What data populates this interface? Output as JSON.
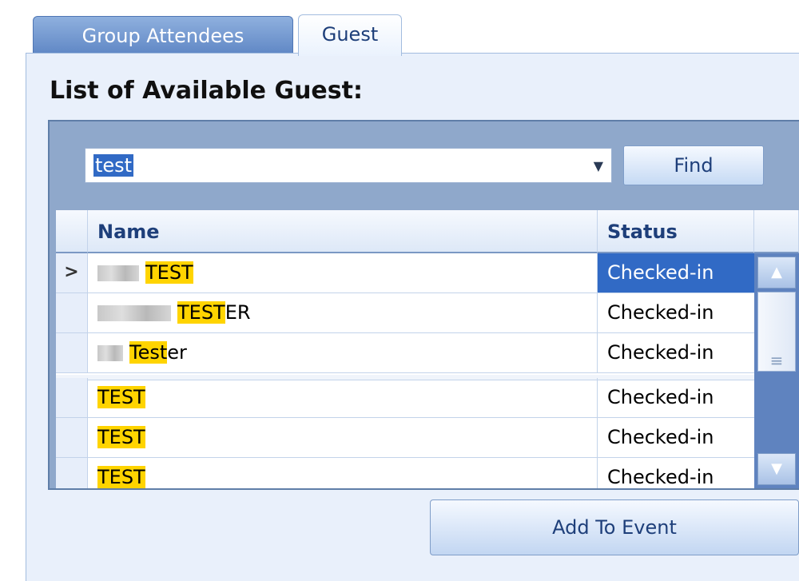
{
  "tabs": [
    {
      "label": "Group Attendees",
      "active": false
    },
    {
      "label": "Guest",
      "active": true
    }
  ],
  "panel_title": "List of Available Guest:",
  "search": {
    "value": "test",
    "find_label": "Find"
  },
  "grid": {
    "columns": [
      "Name",
      "Status"
    ],
    "rows": [
      {
        "selector": ">",
        "name_pre": "TEST",
        "name_post": "",
        "status": "Checked-in",
        "selected": true
      },
      {
        "selector": "",
        "name_pre": "TEST",
        "name_post": "ER",
        "status": "Checked-in",
        "selected": false
      },
      {
        "selector": "",
        "name_pre": "Test",
        "name_post": "er",
        "status": "Checked-in",
        "selected": false
      },
      {
        "selector": "",
        "name_pre": "TEST",
        "name_post": "",
        "status": "Checked-in",
        "selected": false
      },
      {
        "selector": "",
        "name_pre": "TEST",
        "name_post": "",
        "status": "Checked-in",
        "selected": false
      },
      {
        "selector": "",
        "name_pre": "TEST",
        "name_post": "",
        "status": "Checked-in",
        "selected": false
      }
    ]
  },
  "add_button_label": "Add To Event",
  "colors": {
    "accent": "#316ac5",
    "highlight": "#ffd400",
    "tab_inactive": "#6f95cf"
  }
}
